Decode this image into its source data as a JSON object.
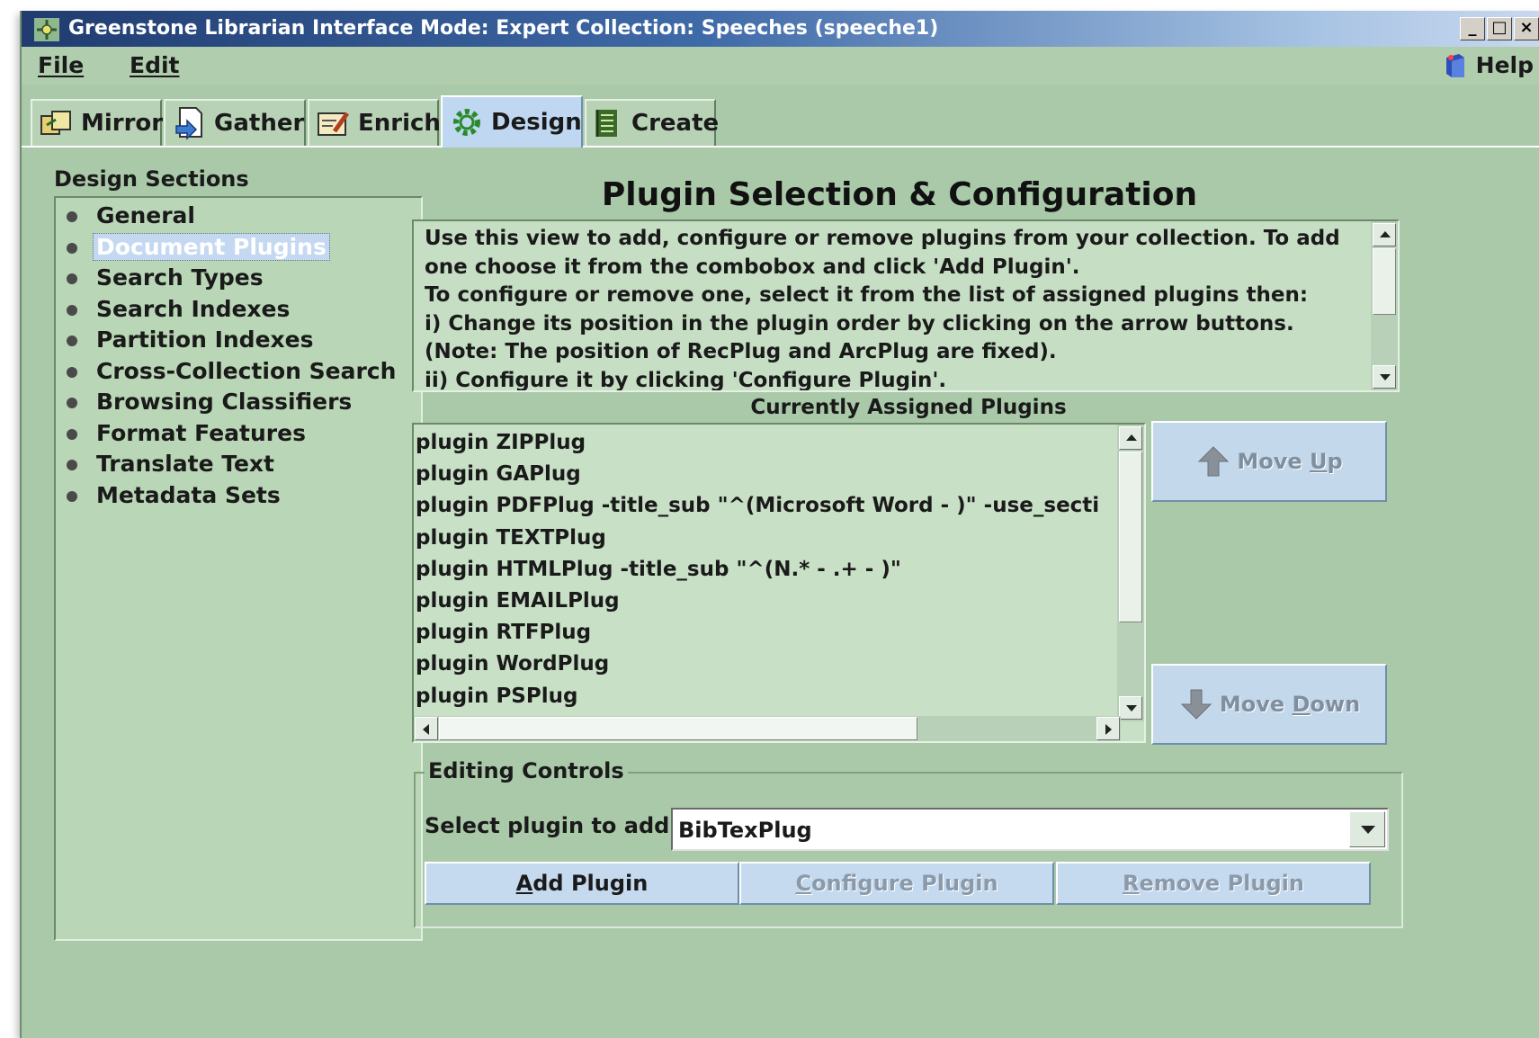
{
  "window": {
    "title": "Greenstone Librarian Interface  Mode: Expert  Collection: Speeches (speeche1)",
    "controls": [
      "_",
      "□",
      "×"
    ]
  },
  "menubar": {
    "file": "File",
    "edit": "Edit",
    "help": "Help"
  },
  "tabs": [
    {
      "label": "Mirror",
      "icon": "mirror-icon"
    },
    {
      "label": "Gather",
      "icon": "gather-icon"
    },
    {
      "label": "Enrich",
      "icon": "enrich-icon"
    },
    {
      "label": "Design",
      "icon": "design-gear-icon",
      "active": true
    },
    {
      "label": "Create",
      "icon": "create-icon"
    }
  ],
  "design_sections": {
    "title": "Design Sections",
    "items": [
      "General",
      "Document Plugins",
      "Search Types",
      "Search Indexes",
      "Partition Indexes",
      "Cross-Collection Search",
      "Browsing Classifiers",
      "Format Features",
      "Translate Text",
      "Metadata Sets"
    ],
    "selected": "Document Plugins"
  },
  "main": {
    "title": "Plugin Selection & Configuration",
    "description_lines": [
      "Use this view to add, configure or remove plugins from your collection. To add",
      "one choose it from the combobox and click 'Add Plugin'.",
      "To configure or remove one, select it from the list of assigned plugins then:",
      "i)   Change its position in the plugin order by clicking on the arrow buttons.",
      "(Note: The position of RecPlug and ArcPlug are fixed).",
      "ii)  Configure it by clicking 'Configure Plugin'."
    ],
    "assigned_title": "Currently Assigned Plugins",
    "assigned_plugins": [
      "plugin ZIPPlug",
      "plugin GAPlug",
      "plugin PDFPlug -title_sub \"^(Microsoft Word - )\" -use_secti",
      "plugin TEXTPlug",
      "plugin HTMLPlug -title_sub \"^(N.* - .+ - )\"",
      "plugin EMAILPlug",
      "plugin RTFPlug",
      "plugin WordPlug",
      "plugin PSPlug"
    ],
    "move_up": {
      "pre": "Move ",
      "key": "U",
      "post": "p"
    },
    "move_down": {
      "pre": "Move ",
      "key": "D",
      "post": "own"
    }
  },
  "editing": {
    "legend": "Editing Controls",
    "select_label": "Select plugin to add:",
    "selected_plugin": "BibTexPlug",
    "add": {
      "key": "A",
      "rest": "dd Plugin"
    },
    "configure": {
      "key": "C",
      "rest": "onfigure Plugin"
    },
    "remove": {
      "key": "R",
      "rest": "emove Plugin"
    }
  }
}
